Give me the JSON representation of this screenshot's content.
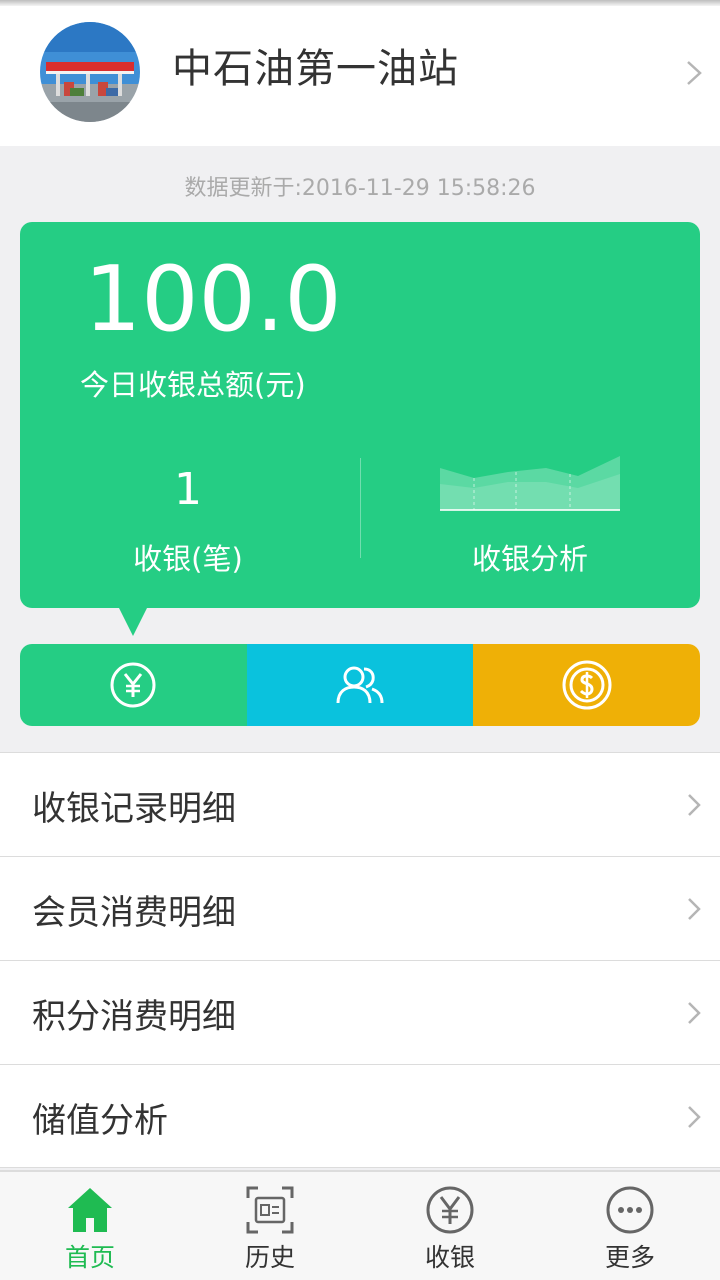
{
  "header": {
    "station_name": "中石油第一油站"
  },
  "update_time": "数据更新于:2016-11-29 15:58:26",
  "summary": {
    "total_amount": "100.0",
    "total_label": "今日收银总额(元)",
    "count_value": "1",
    "count_label": "收银(笔)",
    "analysis_label": "收银分析"
  },
  "segments": [
    {
      "icon": "yuan-circle-icon",
      "color": "#25cd84"
    },
    {
      "icon": "users-icon",
      "color": "#0ac2dd"
    },
    {
      "icon": "dollar-coin-icon",
      "color": "#efb006"
    }
  ],
  "list": {
    "items": [
      {
        "label": "收银记录明细"
      },
      {
        "label": "会员消费明细"
      },
      {
        "label": "积分消费明细"
      },
      {
        "label": "储值分析"
      }
    ]
  },
  "bottom_nav": {
    "items": [
      {
        "label": "首页",
        "icon": "home-icon",
        "active": true
      },
      {
        "label": "历史",
        "icon": "scan-frame-icon",
        "active": false
      },
      {
        "label": "收银",
        "icon": "yuan-circle-icon",
        "active": false
      },
      {
        "label": "更多",
        "icon": "more-dots-icon",
        "active": false
      }
    ]
  },
  "colors": {
    "primary_green": "#25cd84",
    "blue": "#0ac2dd",
    "yellow": "#efb006",
    "nav_active": "#1fbb52"
  }
}
